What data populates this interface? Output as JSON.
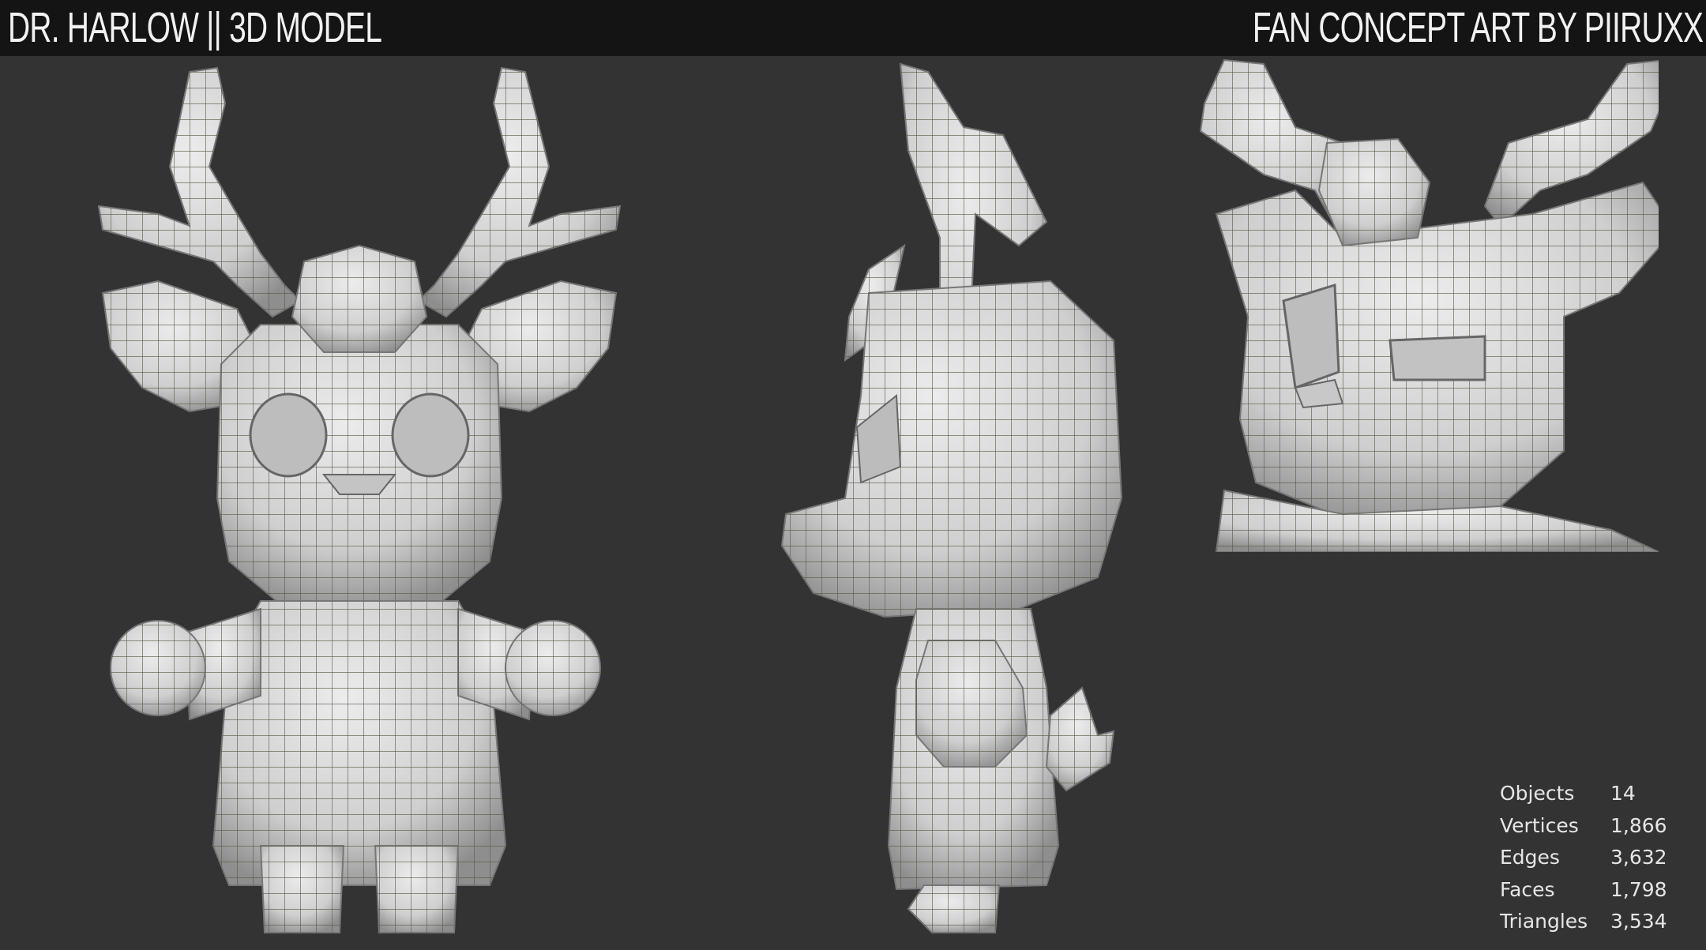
{
  "header": {
    "title": "DR. HARLOW || 3D MODEL",
    "credit": "FAN CONCEPT ART BY PIIRUXX"
  },
  "views": [
    {
      "name": "front-view"
    },
    {
      "name": "side-view"
    },
    {
      "name": "closeup-view"
    }
  ],
  "stats": [
    {
      "label": "Objects",
      "value": "14"
    },
    {
      "label": "Vertices",
      "value": "1,866"
    },
    {
      "label": "Edges",
      "value": "3,632"
    },
    {
      "label": "Faces",
      "value": "1,798"
    },
    {
      "label": "Triangles",
      "value": "3,534"
    }
  ],
  "colors": {
    "background": "#333333",
    "header_bar": "#141414",
    "mesh_fill": "#d6d6d6",
    "mesh_shade": "#9b9b9b",
    "wire": "#5a5442"
  }
}
